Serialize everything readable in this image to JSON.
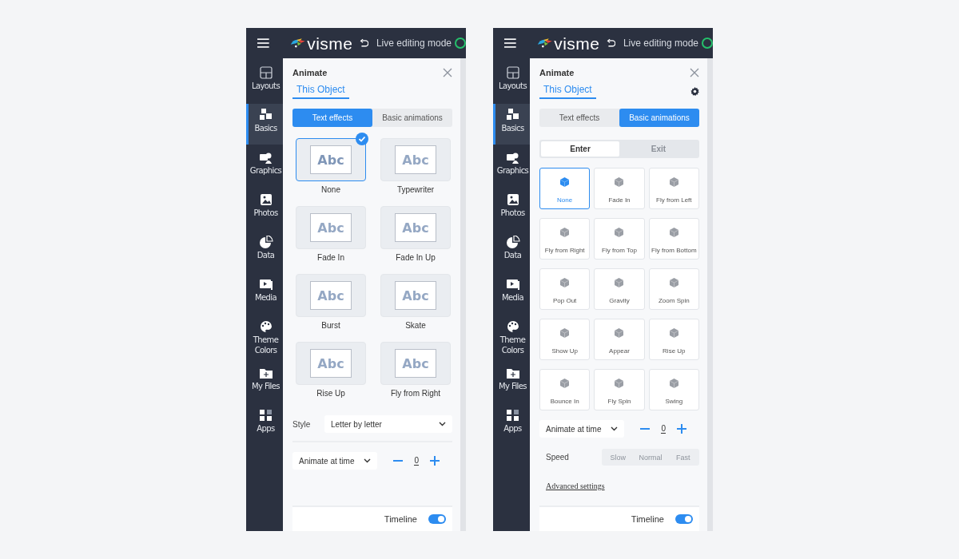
{
  "panels": [
    {
      "header": {
        "logo": "visme",
        "status": "Live editing mode"
      },
      "sidebar": [
        {
          "label": "Layouts",
          "selected": false
        },
        {
          "label": "Basics",
          "selected": true
        },
        {
          "label": "Graphics",
          "selected": false
        },
        {
          "label": "Photos",
          "selected": false
        },
        {
          "label": "Data",
          "selected": false
        },
        {
          "label": "Media",
          "selected": false
        },
        {
          "label": "Theme Colors",
          "selected": false
        },
        {
          "label": "My Files",
          "selected": false
        },
        {
          "label": "Apps",
          "selected": false
        }
      ],
      "animate": {
        "title": "Animate",
        "scope_tab": "This Object",
        "modes": [
          {
            "label": "Text effects",
            "selected": true
          },
          {
            "label": "Basic animations",
            "selected": false
          }
        ],
        "effects": [
          {
            "kind": "text",
            "label": "None",
            "preview": "Abc",
            "selected": true
          },
          {
            "kind": "text",
            "label": "Typewriter",
            "preview": "Abc",
            "selected": false
          },
          {
            "kind": "text",
            "label": "Fade In",
            "preview": "Abc",
            "selected": false
          },
          {
            "kind": "text",
            "label": "Fade In Up",
            "preview": "Abc",
            "selected": false
          },
          {
            "kind": "text",
            "label": "Burst",
            "preview": "Abc",
            "selected": false
          },
          {
            "kind": "text",
            "label": "Skate",
            "preview": "Abc",
            "selected": false
          },
          {
            "kind": "text",
            "label": "Rise Up",
            "preview": "Abc",
            "selected": false
          },
          {
            "kind": "text",
            "label": "Fly from Right",
            "preview": "Abc",
            "selected": false
          }
        ],
        "style": {
          "label": "Style",
          "value": "Letter by letter"
        },
        "timing": {
          "mode": "Animate at time",
          "value": "0"
        },
        "timeline": {
          "label": "Timeline",
          "on": true
        }
      }
    },
    {
      "header": {
        "logo": "visme",
        "status": "Live editing mode"
      },
      "sidebar": [
        {
          "label": "Layouts",
          "selected": false
        },
        {
          "label": "Basics",
          "selected": true
        },
        {
          "label": "Graphics",
          "selected": false
        },
        {
          "label": "Photos",
          "selected": false
        },
        {
          "label": "Data",
          "selected": false
        },
        {
          "label": "Media",
          "selected": false
        },
        {
          "label": "Theme Colors",
          "selected": false
        },
        {
          "label": "My Files",
          "selected": false
        },
        {
          "label": "Apps",
          "selected": false
        }
      ],
      "animate": {
        "title": "Animate",
        "scope_tab": "This Object",
        "settings": true,
        "modes": [
          {
            "label": "Text effects",
            "selected": false
          },
          {
            "label": "Basic animations",
            "selected": true
          }
        ],
        "direction": [
          {
            "label": "Enter",
            "selected": true
          },
          {
            "label": "Exit",
            "selected": false
          }
        ],
        "effects": [
          {
            "kind": "object",
            "label": "None",
            "selected": true
          },
          {
            "kind": "object",
            "label": "Fade In",
            "selected": false
          },
          {
            "kind": "object",
            "label": "Fly from Left",
            "selected": false
          },
          {
            "kind": "object",
            "label": "Fly from Right",
            "selected": false
          },
          {
            "kind": "object",
            "label": "Fly from Top",
            "selected": false
          },
          {
            "kind": "object",
            "label": "Fly from Bottom",
            "selected": false
          },
          {
            "kind": "object",
            "label": "Pop Out",
            "selected": false
          },
          {
            "kind": "object",
            "label": "Gravity",
            "selected": false
          },
          {
            "kind": "object",
            "label": "Zoom Spin",
            "selected": false
          },
          {
            "kind": "object",
            "label": "Show Up",
            "selected": false
          },
          {
            "kind": "object",
            "label": "Appear",
            "selected": false
          },
          {
            "kind": "object",
            "label": "Rise Up",
            "selected": false
          },
          {
            "kind": "object",
            "label": "Bounce In",
            "selected": false
          },
          {
            "kind": "object",
            "label": "Fly Spin",
            "selected": false
          },
          {
            "kind": "object",
            "label": "Swing",
            "selected": false
          }
        ],
        "timing": {
          "mode": "Animate at time",
          "value": "0"
        },
        "speed": {
          "label": "Speed",
          "options": [
            {
              "label": "Slow",
              "disabled": true
            },
            {
              "label": "Normal",
              "disabled": true
            },
            {
              "label": "Fast",
              "disabled": true
            }
          ]
        },
        "advanced_link": "Advanced settings",
        "timeline": {
          "label": "Timeline",
          "on": true
        }
      }
    }
  ]
}
